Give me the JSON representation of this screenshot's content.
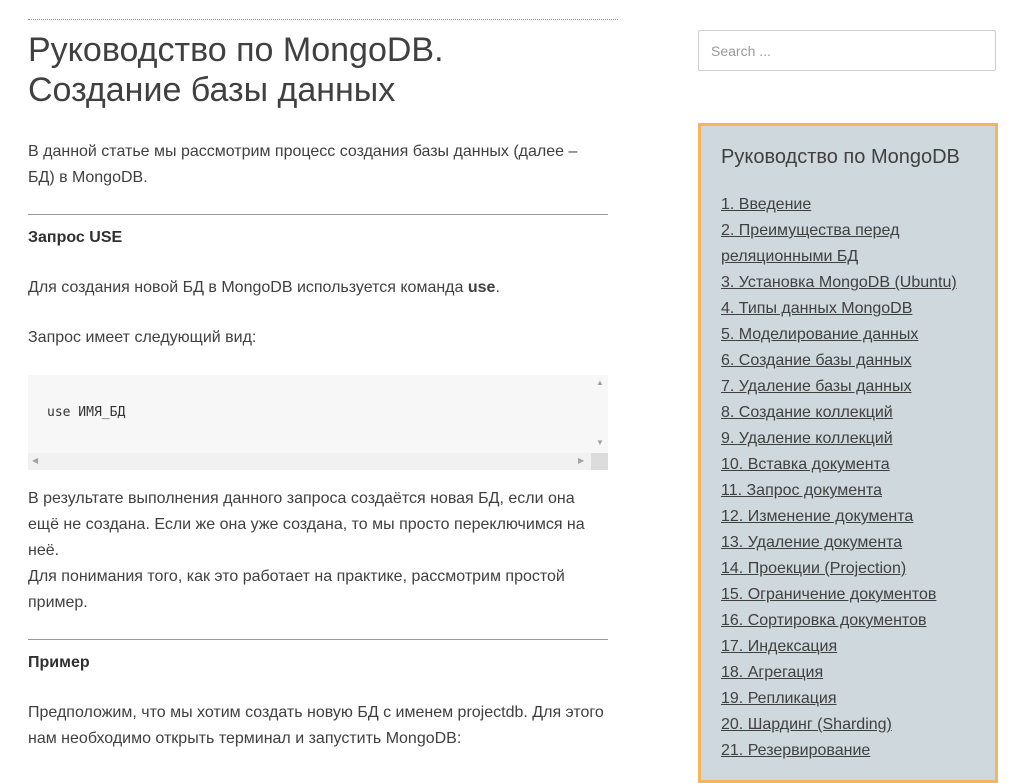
{
  "article": {
    "title": "Руководство по MongoDB. Создание базы данных",
    "intro": "В данной статье мы рассмотрим процесс создания базы данных (далее – БД) в MongoDB.",
    "section1_heading": "Запрос USE",
    "section1_text_before": "Для создания новой БД в MongoDB используется команда ",
    "section1_text_bold": "use",
    "section1_text_after": ".",
    "query_form_text": "Запрос имеет следующий вид:",
    "code": "use ИМЯ_БД",
    "result_text1": "В результате выполнения данного запроса создаётся новая БД, если она ещё не создана. Если же она уже создана, то мы просто переключимся на неё.",
    "result_text2": "Для понимания того, как это работает на практике, рассмотрим простой пример.",
    "section2_heading": "Пример",
    "example_text": "Предположим, что мы хотим создать новую БД с именем projectdb. Для этого нам необходимо открыть терминал и запустить MongoDB:"
  },
  "sidebar": {
    "search_placeholder": "Search ...",
    "widget_title": "Руководство по MongoDB",
    "toc": [
      "1. Введение",
      "2. Преимущества перед реляционными БД",
      "3. Установка MongoDB (Ubuntu)",
      "4. Типы данных MongoDB",
      "5. Моделирование данных",
      "6. Создание базы данных",
      "7. Удаление базы данных",
      "8. Создание коллекций",
      "9. Удаление коллекций",
      "10. Вставка документа",
      "11. Запрос документа",
      "12. Изменение документа",
      "13. Удаление документа",
      "14. Проекции (Projection)",
      "15. Ограничение документов",
      "16. Сортировка документов",
      "17. Индексация",
      "18. Агрегация",
      "19. Репликация",
      "20. Шардинг (Sharding)",
      "21. Резервирование"
    ]
  },
  "colors": {
    "widget_bg": "#cfd8dc",
    "widget_border": "#f4b65a",
    "text": "#404040"
  }
}
